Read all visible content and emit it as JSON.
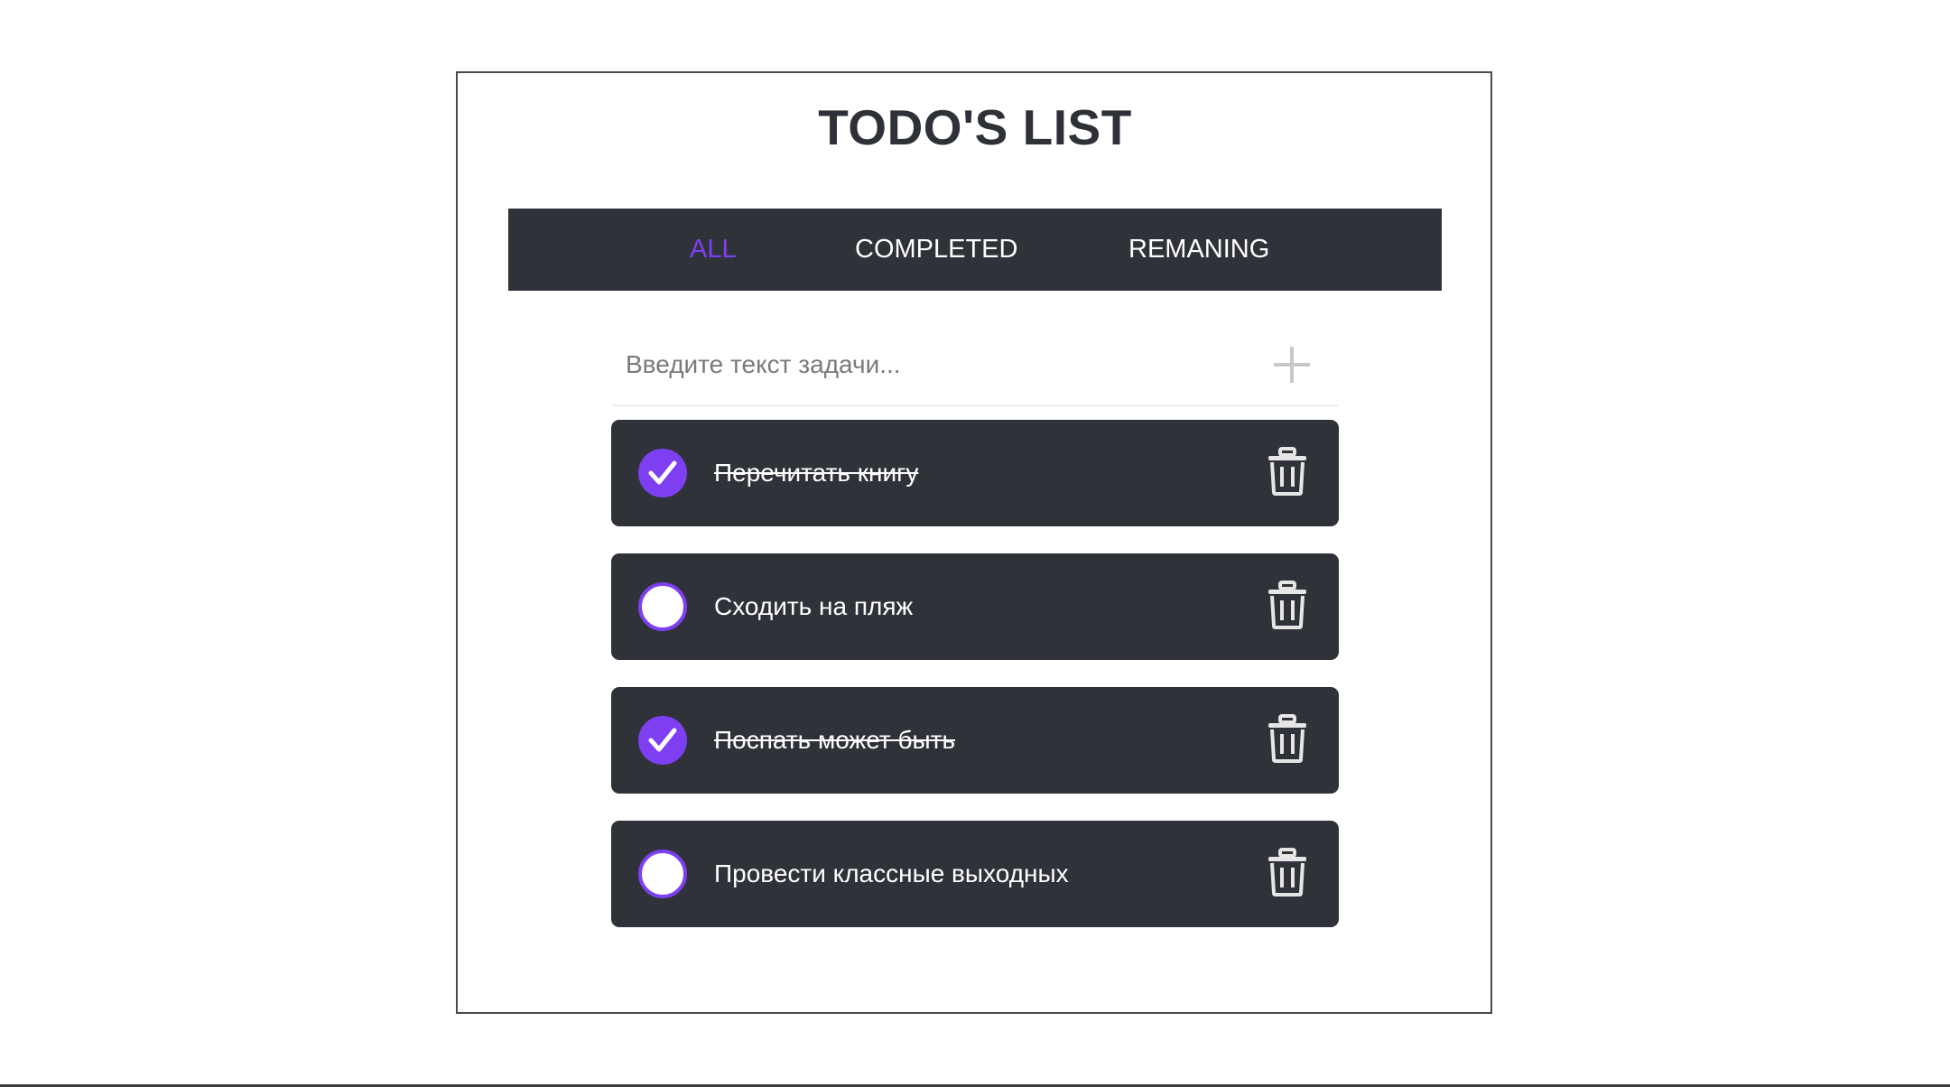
{
  "app": {
    "title": "TODO'S LIST"
  },
  "tabs": [
    {
      "label": "ALL",
      "active": true
    },
    {
      "label": "COMPLETED",
      "active": false
    },
    {
      "label": "REMANING",
      "active": false
    }
  ],
  "add_task": {
    "placeholder": "Введите текст задачи...",
    "value": "",
    "button_icon": "plus-icon"
  },
  "todos": [
    {
      "text": "Перечитать книгу",
      "completed": true
    },
    {
      "text": "Сходить на пляж",
      "completed": false
    },
    {
      "text": "Поспать может быть",
      "completed": true
    },
    {
      "text": "Провести классные выходных",
      "completed": false
    }
  ],
  "icons": {
    "check": "check-icon",
    "delete": "trash-icon"
  },
  "colors": {
    "accent": "#7e3ff2",
    "bar": "#30323a",
    "title": "#2f3139",
    "plus": "#c8c8c8",
    "trash": "#e6e6e6"
  }
}
